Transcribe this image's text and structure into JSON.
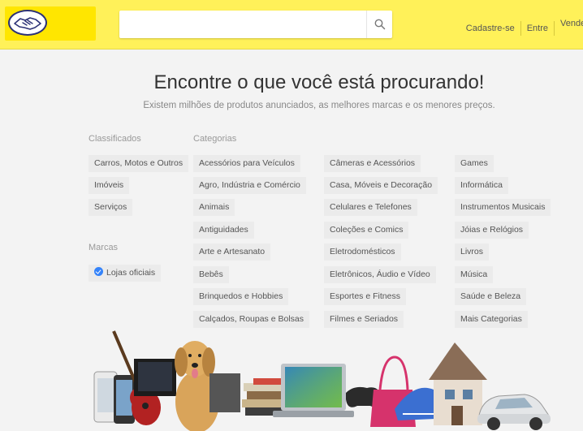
{
  "header": {
    "search": {
      "value": "",
      "placeholder": ""
    },
    "nav": [
      "Cadastre-se",
      "Entre",
      "Vende"
    ]
  },
  "hero": {
    "title": "Encontre o que você está procurando!",
    "subtitle": "Existem milhões de produtos anunciados, as melhores marcas e os menores preços."
  },
  "classificados": {
    "label": "Classificados",
    "items": [
      "Carros, Motos e Outros",
      "Imóveis",
      "Serviços"
    ]
  },
  "marcas": {
    "label": "Marcas",
    "items": [
      "Lojas oficiais"
    ]
  },
  "categorias": {
    "label": "Categorias",
    "col1": [
      "Acessórios para Veículos",
      "Agro, Indústria e Comércio",
      "Animais",
      "Antiguidades",
      "Arte e Artesanato",
      "Bebês",
      "Brinquedos e Hobbies",
      "Calçados, Roupas e Bolsas"
    ],
    "col2": [
      "Câmeras e Acessórios",
      "Casa, Móveis e Decoração",
      "Celulares e Telefones",
      "Coleções e Comics",
      "Eletrodomésticos",
      "Eletrônicos, Áudio e Vídeo",
      "Esportes e Fitness",
      "Filmes e Seriados"
    ],
    "col3": [
      "Games",
      "Informática",
      "Instrumentos Musicais",
      "Jóias e Relógios",
      "Livros",
      "Música",
      "Saúde e Beleza",
      "Mais Categorias"
    ]
  },
  "colors": {
    "header": "#fff159",
    "logo": "#ffe600",
    "brand_blue": "#2d3277",
    "background": "#f3f3f3",
    "pill": "#ebebeb"
  }
}
